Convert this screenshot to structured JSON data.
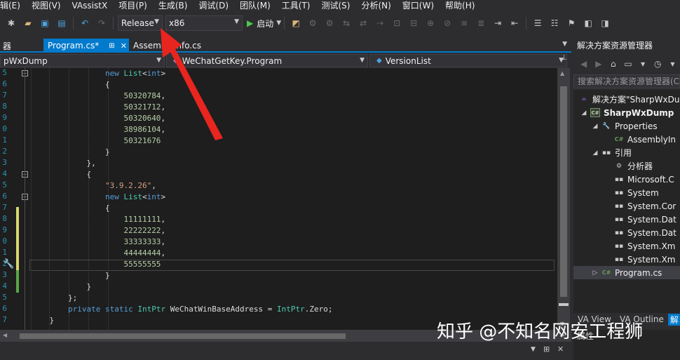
{
  "menu": [
    "辑(E)",
    "视图(V)",
    "VAssistX",
    "项目(P)",
    "生成(B)",
    "调试(D)",
    "团队(M)",
    "工具(T)",
    "测试(S)",
    "分析(N)",
    "窗口(W)",
    "帮助(H)"
  ],
  "toolbar": {
    "configuration": "Release",
    "platform": "x86",
    "start_label": "启动"
  },
  "tabs": {
    "left_partial": "器",
    "active": "Program.cs*",
    "pin_glyph": "⊞",
    "close_glyph": "✕",
    "inactive": "AssemblyInfo.cs"
  },
  "nav": {
    "project": "pWxDump",
    "class": "WeChatGetKey.Program",
    "member": "VersionList"
  },
  "editor": {
    "line_numbers": [
      "5",
      "6",
      "7",
      "8",
      "9",
      "0",
      "1",
      "2",
      "3",
      "4",
      "5",
      "6",
      "7",
      "8",
      "9",
      "0",
      "1",
      "2",
      "3",
      "4",
      "5",
      "6",
      "7"
    ],
    "lines": [
      {
        "indent": "                ",
        "tokens": [
          {
            "t": "new ",
            "c": "kw"
          },
          {
            "t": "List",
            "c": "ty"
          },
          {
            "t": "<",
            "c": "plain"
          },
          {
            "t": "int",
            "c": "kw"
          },
          {
            "t": ">",
            "c": "plain"
          }
        ]
      },
      {
        "indent": "                ",
        "tokens": [
          {
            "t": "{",
            "c": "plain"
          }
        ]
      },
      {
        "indent": "                    ",
        "tokens": [
          {
            "t": "50320784",
            "c": "num"
          },
          {
            "t": ",",
            "c": "plain"
          }
        ]
      },
      {
        "indent": "                    ",
        "tokens": [
          {
            "t": "50321712",
            "c": "num"
          },
          {
            "t": ",",
            "c": "plain"
          }
        ]
      },
      {
        "indent": "                    ",
        "tokens": [
          {
            "t": "50320640",
            "c": "num"
          },
          {
            "t": ",",
            "c": "plain"
          }
        ]
      },
      {
        "indent": "                    ",
        "tokens": [
          {
            "t": "38986104",
            "c": "num"
          },
          {
            "t": ",",
            "c": "plain"
          }
        ]
      },
      {
        "indent": "                    ",
        "tokens": [
          {
            "t": "50321676",
            "c": "num"
          }
        ]
      },
      {
        "indent": "                ",
        "tokens": [
          {
            "t": "}",
            "c": "plain"
          }
        ]
      },
      {
        "indent": "            ",
        "tokens": [
          {
            "t": "},",
            "c": "plain"
          }
        ]
      },
      {
        "indent": "            ",
        "tokens": [
          {
            "t": "{",
            "c": "plain"
          }
        ]
      },
      {
        "indent": "                ",
        "tokens": [
          {
            "t": "\"3.9.2.26\"",
            "c": "str"
          },
          {
            "t": ",",
            "c": "plain"
          }
        ]
      },
      {
        "indent": "                ",
        "tokens": [
          {
            "t": "new ",
            "c": "kw"
          },
          {
            "t": "List",
            "c": "ty"
          },
          {
            "t": "<",
            "c": "plain"
          },
          {
            "t": "int",
            "c": "kw"
          },
          {
            "t": ">",
            "c": "plain"
          }
        ]
      },
      {
        "indent": "                ",
        "tokens": [
          {
            "t": "{",
            "c": "plain"
          }
        ]
      },
      {
        "indent": "                    ",
        "tokens": [
          {
            "t": "11111111",
            "c": "num"
          },
          {
            "t": ",",
            "c": "plain"
          }
        ]
      },
      {
        "indent": "                    ",
        "tokens": [
          {
            "t": "22222222",
            "c": "num"
          },
          {
            "t": ",",
            "c": "plain"
          }
        ]
      },
      {
        "indent": "                    ",
        "tokens": [
          {
            "t": "33333333",
            "c": "num"
          },
          {
            "t": ",",
            "c": "plain"
          }
        ]
      },
      {
        "indent": "                    ",
        "tokens": [
          {
            "t": "44444444",
            "c": "num"
          },
          {
            "t": ",",
            "c": "plain"
          }
        ]
      },
      {
        "indent": "                    ",
        "tokens": [
          {
            "t": "55555555",
            "c": "num"
          }
        ]
      },
      {
        "indent": "                ",
        "tokens": [
          {
            "t": "}",
            "c": "plain"
          }
        ]
      },
      {
        "indent": "            ",
        "tokens": [
          {
            "t": "}",
            "c": "plain"
          }
        ]
      },
      {
        "indent": "        ",
        "tokens": [
          {
            "t": "};",
            "c": "plain"
          }
        ]
      },
      {
        "indent": "        ",
        "tokens": [
          {
            "t": "private ",
            "c": "kw"
          },
          {
            "t": "static ",
            "c": "kw"
          },
          {
            "t": "IntPtr",
            "c": "ty"
          },
          {
            "t": " WeChatWinBaseAddress = ",
            "c": "plain"
          },
          {
            "t": "IntPtr",
            "c": "ty"
          },
          {
            "t": ".Zero;",
            "c": "plain"
          }
        ]
      },
      {
        "indent": "    ",
        "tokens": [
          {
            "t": "}",
            "c": "plain"
          }
        ]
      }
    ]
  },
  "solution_explorer": {
    "title": "解决方案资源管理器",
    "search_placeholder": "搜索解决方案资源管理器(C",
    "items": [
      {
        "label": "解决方案\"SharpWxDu",
        "icon": "solution-icon",
        "bold": false
      },
      {
        "label": "SharpWxDump",
        "icon": "csharp-project-icon",
        "bold": true
      },
      {
        "label": "Properties",
        "icon": "wrench-icon",
        "bold": false
      },
      {
        "label": "AssemblyIn",
        "icon": "csharp-file-icon",
        "bold": false
      },
      {
        "label": "引用",
        "icon": "references-icon",
        "bold": false
      },
      {
        "label": "分析器",
        "icon": "analyzer-icon",
        "bold": false
      },
      {
        "label": "Microsoft.C",
        "icon": "reference-icon",
        "bold": false
      },
      {
        "label": "System",
        "icon": "reference-icon",
        "bold": false
      },
      {
        "label": "System.Cor",
        "icon": "reference-icon",
        "bold": false
      },
      {
        "label": "System.Dat",
        "icon": "reference-icon",
        "bold": false
      },
      {
        "label": "System.Dat",
        "icon": "reference-icon",
        "bold": false
      },
      {
        "label": "System.Xm",
        "icon": "reference-icon",
        "bold": false
      },
      {
        "label": "System.Xm",
        "icon": "reference-icon",
        "bold": false
      },
      {
        "label": "Program.cs",
        "icon": "csharp-file-icon",
        "bold": false
      }
    ],
    "bottom_tabs": [
      "VA View",
      "VA Outline",
      "解"
    ]
  },
  "properties_title": "属性",
  "watermark": "知乎 @不知名网安工程狮",
  "colors": {
    "accent": "#007acc",
    "annotation_arrow": "#e8251f"
  }
}
